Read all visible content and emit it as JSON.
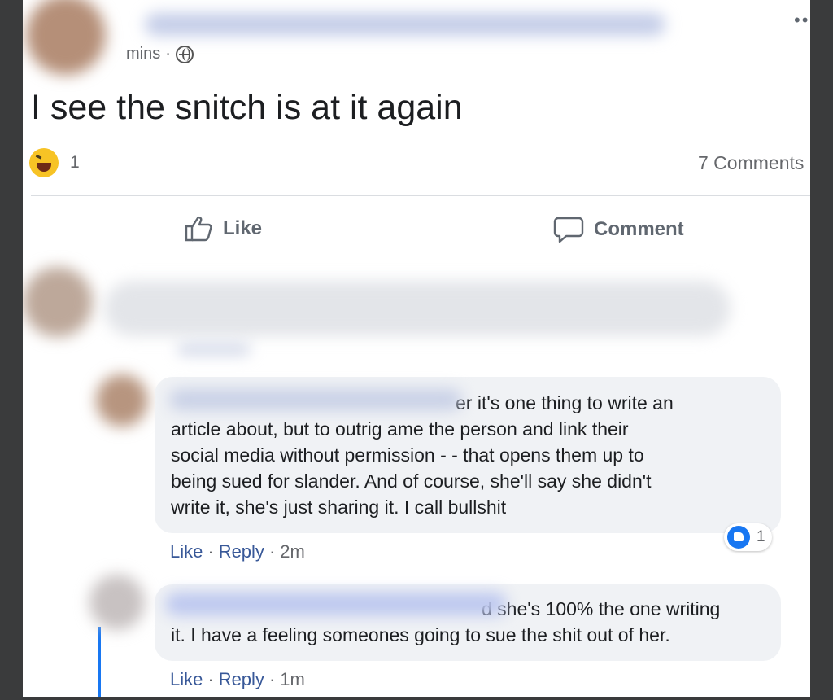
{
  "post": {
    "timestamp": "mins",
    "separator": "·",
    "text": "I see the snitch is at it again",
    "reaction_count": "1",
    "comments_count": "7 Comments",
    "more_icon": "more-options-icon",
    "privacy_icon": "globe-icon"
  },
  "actions": {
    "like_label": "Like",
    "comment_label": "Comment"
  },
  "comments": [
    {
      "lines": [
        "er it's one thing to write an",
        "article about, but to outrig    ame the person and link their",
        "social media without permission - - that opens them up to",
        "being sued for slander. And of course, she'll say she didn't",
        "write it, she's just sharing it. I call bullshit"
      ],
      "like_label": "Like",
      "reply_label": "Reply",
      "sep": "·",
      "time": "2m",
      "like_count": "1"
    },
    {
      "lines": [
        "d she's 100% the one writing",
        "it. I have a feeling someones going to sue the shit out of her."
      ],
      "like_label": "Like",
      "reply_label": "Reply",
      "sep": "·",
      "time": "1m"
    }
  ],
  "colors": {
    "link": "#385898",
    "accent": "#1877f2",
    "bubble": "#f0f2f5"
  }
}
